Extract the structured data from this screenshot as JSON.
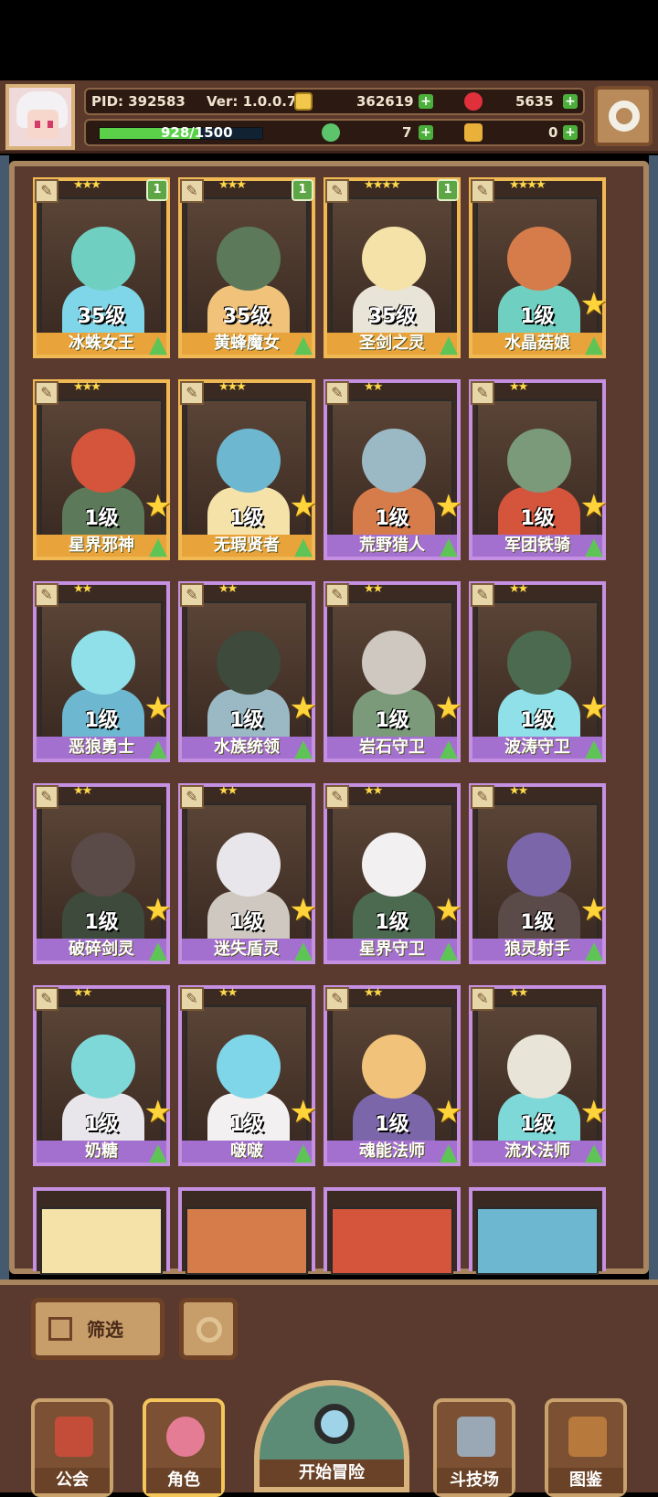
{
  "header": {
    "pid": "PID: 392583",
    "version": "Ver: 1.0.0.7",
    "gold": "362619",
    "gems": "5635",
    "exp": "928/1500",
    "exp_ratio": 0.619,
    "clover": "7",
    "key": "0"
  },
  "cards": [
    {
      "name": "冰蛛女王",
      "level": "35级",
      "stars": "★★★",
      "color": "gold",
      "badge": "1"
    },
    {
      "name": "黄蜂魔女",
      "level": "35级",
      "stars": "★★★",
      "color": "gold",
      "badge": "1"
    },
    {
      "name": "圣剑之灵",
      "level": "35级",
      "stars": "★★★★",
      "color": "gold",
      "badge": "1"
    },
    {
      "name": "水晶菇娘",
      "level": "1级",
      "stars": "★★★★",
      "color": "gold",
      "badge": ""
    },
    {
      "name": "星界邪神",
      "level": "1级",
      "stars": "★★★",
      "color": "gold",
      "badge": ""
    },
    {
      "name": "无瑕贤者",
      "level": "1级",
      "stars": "★★★",
      "color": "gold",
      "badge": ""
    },
    {
      "name": "荒野猎人",
      "level": "1级",
      "stars": "★★",
      "color": "purple",
      "badge": ""
    },
    {
      "name": "军团铁骑",
      "level": "1级",
      "stars": "★★",
      "color": "purple",
      "badge": ""
    },
    {
      "name": "恶狼勇士",
      "level": "1级",
      "stars": "★★",
      "color": "purple",
      "badge": ""
    },
    {
      "name": "水族统领",
      "level": "1级",
      "stars": "★★",
      "color": "purple",
      "badge": ""
    },
    {
      "name": "岩石守卫",
      "level": "1级",
      "stars": "★★",
      "color": "purple",
      "badge": ""
    },
    {
      "name": "波涛守卫",
      "level": "1级",
      "stars": "★★",
      "color": "purple",
      "badge": ""
    },
    {
      "name": "破碎剑灵",
      "level": "1级",
      "stars": "★★",
      "color": "purple",
      "badge": ""
    },
    {
      "name": "迷失盾灵",
      "level": "1级",
      "stars": "★★",
      "color": "purple",
      "badge": ""
    },
    {
      "name": "星界守卫",
      "level": "1级",
      "stars": "★★",
      "color": "purple",
      "badge": ""
    },
    {
      "name": "狼灵射手",
      "level": "1级",
      "stars": "★★",
      "color": "purple",
      "badge": ""
    },
    {
      "name": "奶糖",
      "level": "1级",
      "stars": "★★",
      "color": "purple",
      "badge": ""
    },
    {
      "name": "啵啵",
      "level": "1级",
      "stars": "★★",
      "color": "purple",
      "badge": ""
    },
    {
      "name": "魂能法师",
      "level": "1级",
      "stars": "★★",
      "color": "purple",
      "badge": ""
    },
    {
      "name": "流水法师",
      "level": "1级",
      "stars": "★★",
      "color": "purple",
      "badge": ""
    }
  ],
  "filter": {
    "label": "筛选"
  },
  "nav": {
    "guild": "公会",
    "character": "角色",
    "adventure": "开始冒险",
    "arena": "斗技场",
    "codex": "图鉴"
  }
}
